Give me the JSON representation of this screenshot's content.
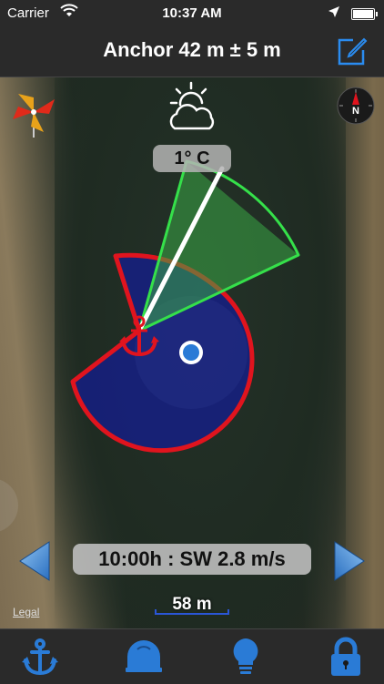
{
  "status_bar": {
    "carrier": "Carrier",
    "time": "10:37 AM"
  },
  "nav": {
    "title": "Anchor 42 m ± 5 m",
    "edit_icon": "compose-icon"
  },
  "map": {
    "temperature": "1° C",
    "forecast": "10:00h : SW 2.8 m/s",
    "scale": "58 m",
    "legal": "Legal",
    "weather_icon": "partly-cloudy-icon",
    "compass_icon": "compass-icon",
    "compass_label": "N",
    "wind_icon": "pinwheel-icon"
  },
  "tabs": [
    {
      "name": "anchor",
      "icon": "anchor-icon"
    },
    {
      "name": "alarm",
      "icon": "bell-icon"
    },
    {
      "name": "light",
      "icon": "lightbulb-icon"
    },
    {
      "name": "lock",
      "icon": "lock-icon"
    }
  ],
  "colors": {
    "accent": "#2a7bd6",
    "anchor_zone_fill": "#1e2f8a",
    "anchor_zone_stroke": "#e0141e",
    "wind_sector_fill": "#3aa845",
    "wind_sector_stroke": "#35e04a"
  }
}
